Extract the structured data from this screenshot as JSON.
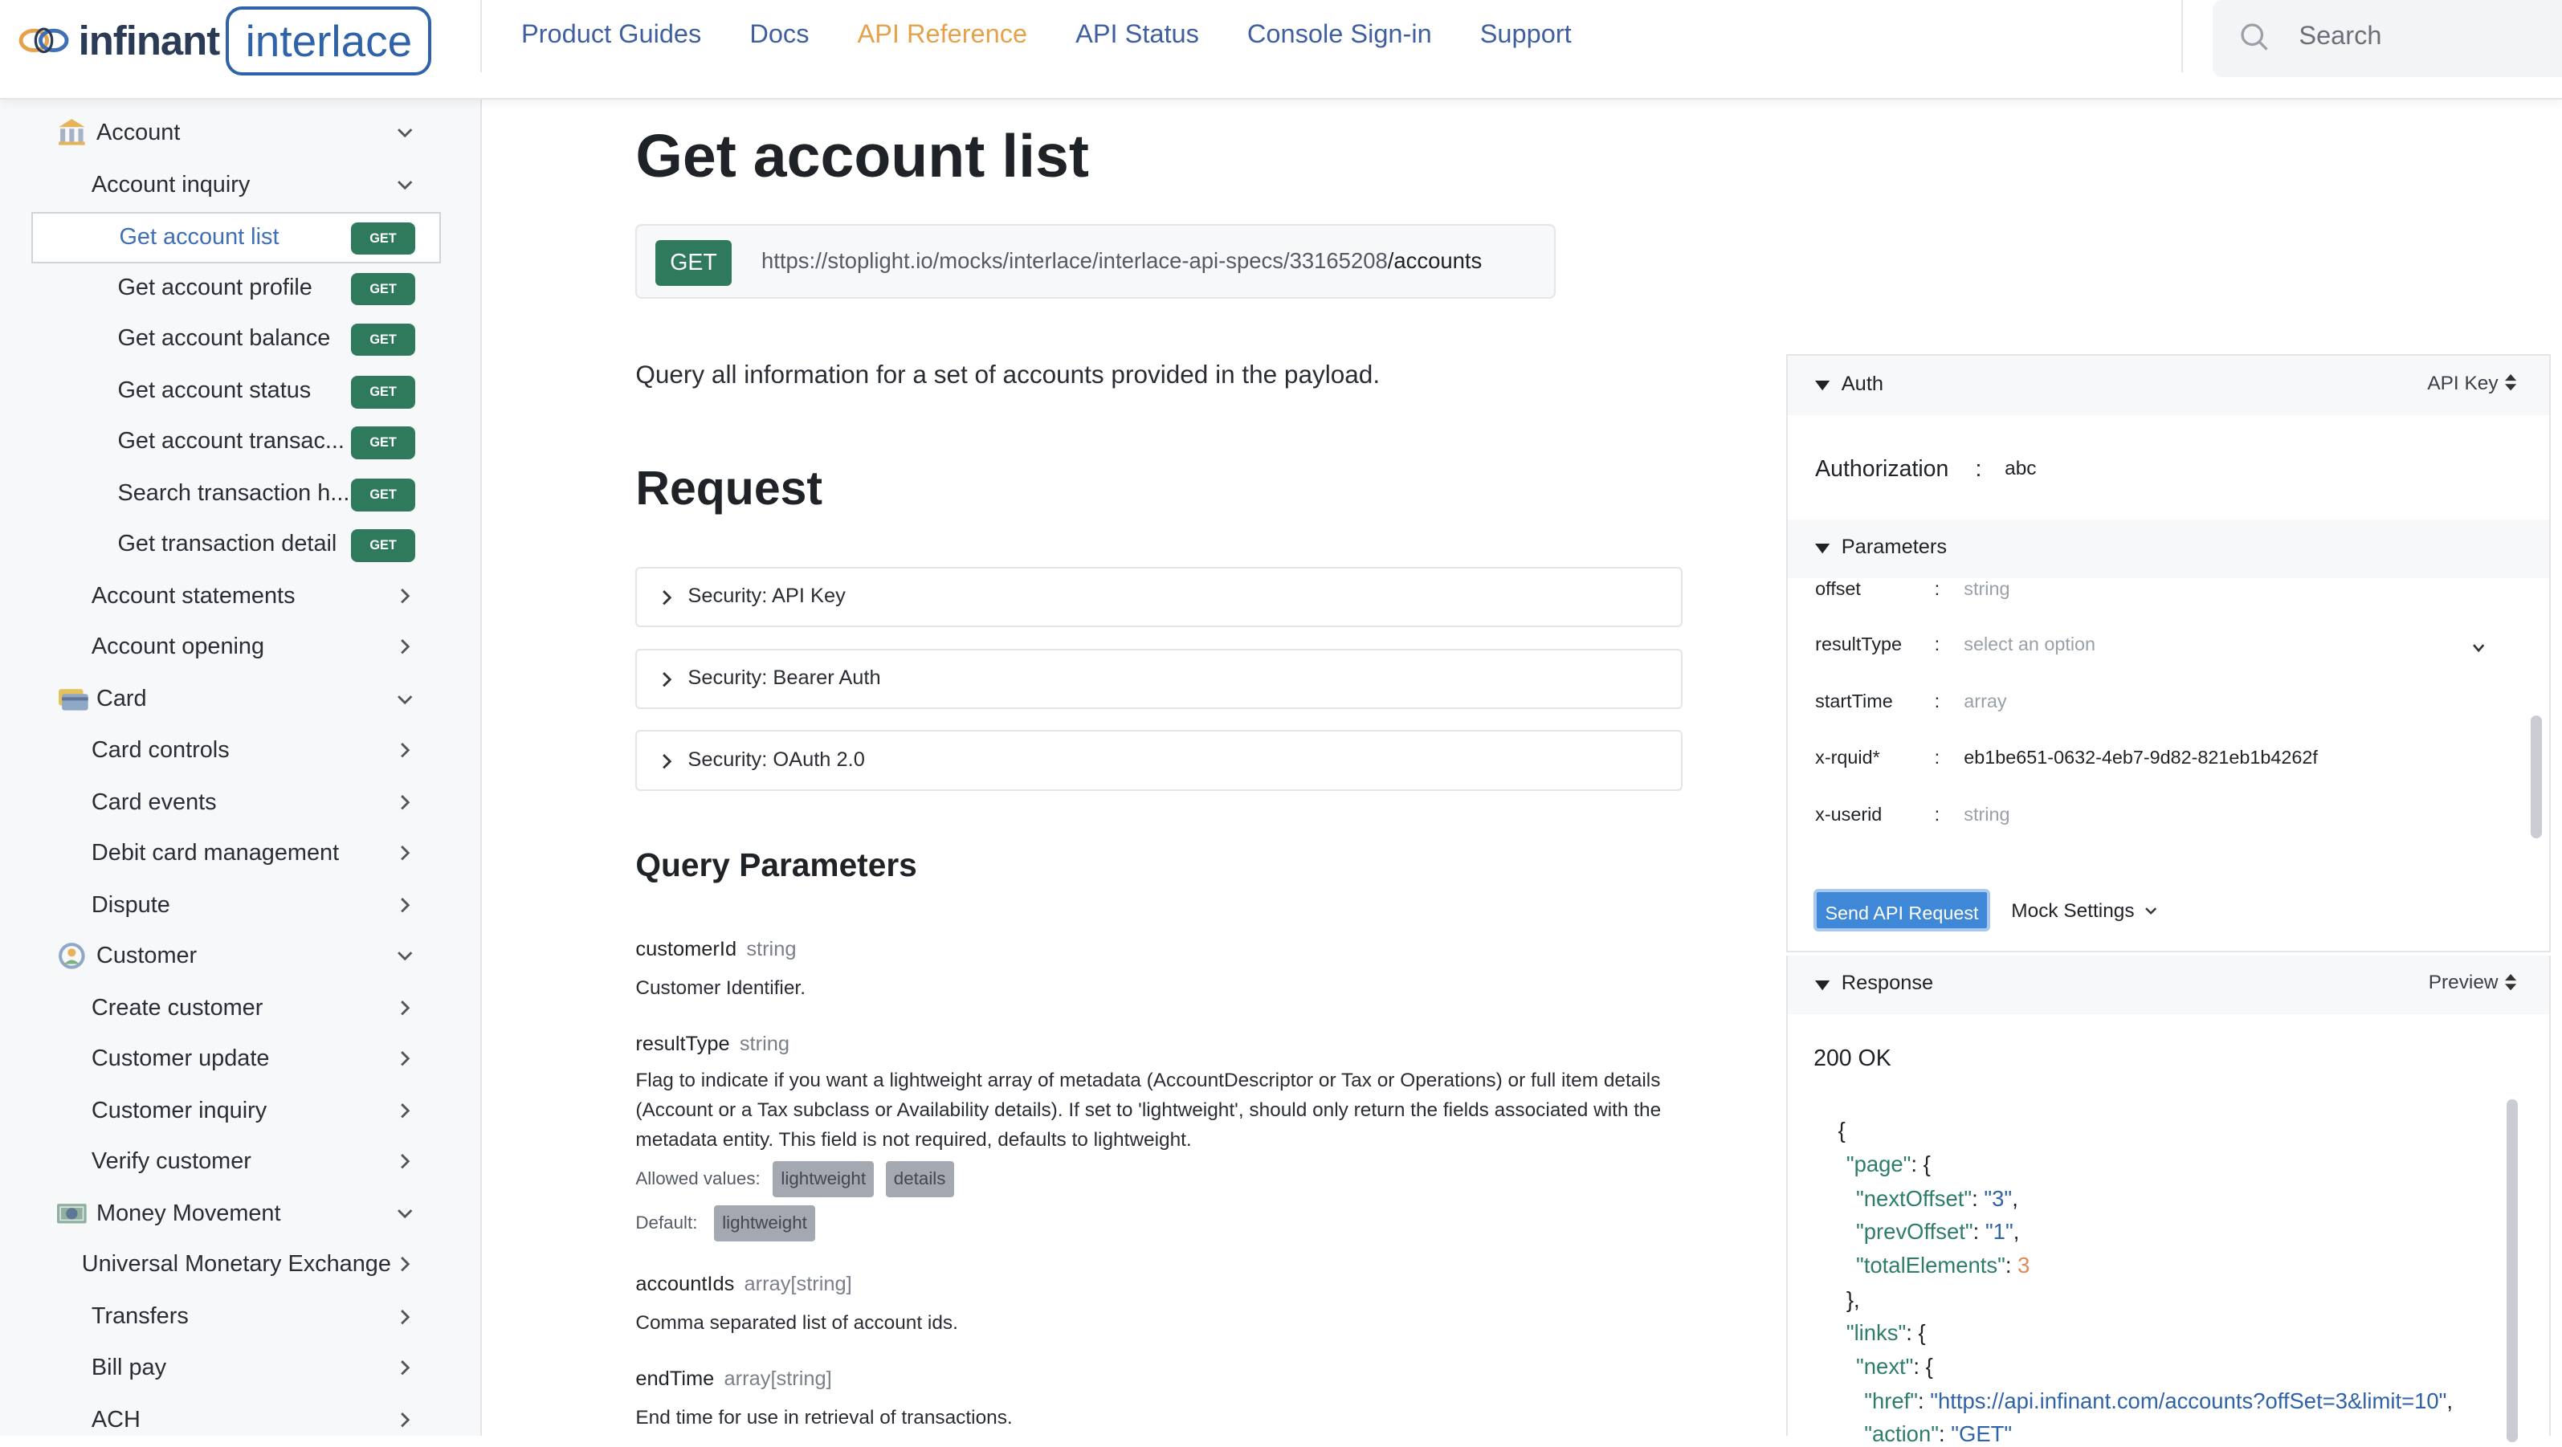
{
  "brand": {
    "logo_text": "infinant",
    "badge_text": "interlace"
  },
  "nav": [
    {
      "label": "Product Guides",
      "active": false
    },
    {
      "label": "Docs",
      "active": false
    },
    {
      "label": "API Reference",
      "active": true
    },
    {
      "label": "API Status",
      "active": false
    },
    {
      "label": "Console Sign-in",
      "active": false
    },
    {
      "label": "Support",
      "active": false
    }
  ],
  "search": {
    "placeholder": "Search"
  },
  "sidebar": {
    "items": [
      {
        "label": "Account",
        "icon": "bank-icon",
        "expanded": true
      },
      {
        "label": "Account inquiry",
        "expanded": true
      },
      {
        "label": "Get account list",
        "badge": "GET",
        "selected": true
      },
      {
        "label": "Get account profile",
        "badge": "GET"
      },
      {
        "label": "Get account balance",
        "badge": "GET"
      },
      {
        "label": "Get account status",
        "badge": "GET"
      },
      {
        "label": "Get account transac...",
        "badge": "GET"
      },
      {
        "label": "Search transaction h...",
        "badge": "GET"
      },
      {
        "label": "Get transaction detail",
        "badge": "GET"
      },
      {
        "label": "Account statements"
      },
      {
        "label": "Account opening"
      },
      {
        "label": "Card",
        "icon": "card-icon",
        "expanded": true
      },
      {
        "label": "Card controls"
      },
      {
        "label": "Card events"
      },
      {
        "label": "Debit card management"
      },
      {
        "label": "Dispute"
      },
      {
        "label": "Customer",
        "icon": "customer-icon",
        "expanded": true
      },
      {
        "label": "Create customer"
      },
      {
        "label": "Customer update"
      },
      {
        "label": "Customer inquiry"
      },
      {
        "label": "Verify customer"
      },
      {
        "label": "Money Movement",
        "icon": "money-icon",
        "expanded": true
      },
      {
        "label": "Universal Monetary Exchange"
      },
      {
        "label": "Transfers"
      },
      {
        "label": "Bill pay"
      },
      {
        "label": "ACH"
      }
    ]
  },
  "main": {
    "title": "Get account list",
    "method": "GET",
    "url_base": "https://stoplight.io/mocks/interlace/interlace-api-specs/33165208",
    "url_path": "/accounts",
    "description": "Query all information for a set of accounts provided in the payload.",
    "request_heading": "Request",
    "security": [
      "Security: API Key",
      "Security: Bearer Auth",
      "Security: OAuth 2.0"
    ],
    "query_heading": "Query Parameters",
    "params": [
      {
        "name": "customerId",
        "type": "string",
        "desc": "Customer Identifier."
      },
      {
        "name": "resultType",
        "type": "string",
        "desc": "Flag to indicate if you want a lightweight array of metadata (AccountDescriptor or Tax or Operations) or full item details (Account or a Tax subclass or Availability details). If set to 'lightweight', should only return the fields associated with the metadata entity. This field is not required, defaults to lightweight."
      },
      {
        "name": "accountIds",
        "type": "array[string]",
        "desc": "Comma separated list of account ids."
      },
      {
        "name": "endTime",
        "type": "array[string]",
        "desc": "End time for use in retrieval of transactions."
      }
    ],
    "allowed_label": "Allowed values:",
    "allowed_values": [
      "lightweight",
      "details"
    ],
    "default_label": "Default:",
    "default_value": "lightweight"
  },
  "panel": {
    "auth_title": "Auth",
    "auth_mode": "API Key",
    "auth_key": "Authorization",
    "auth_value": "abc",
    "params_title": "Parameters",
    "rows": [
      {
        "name": "offset",
        "value": "string",
        "filled": false
      },
      {
        "name": "resultType",
        "value": "select an option",
        "filled": false
      },
      {
        "name": "startTime",
        "value": "array",
        "filled": false
      },
      {
        "name": "x-rquid*",
        "value": "eb1be651-0632-4eb7-9d82-821eb1b4262f",
        "filled": true
      },
      {
        "name": "x-userid",
        "value": "string",
        "filled": false
      }
    ],
    "send_label": "Send API Request",
    "mock_label": "Mock Settings",
    "response_title": "Response",
    "response_mode": "Preview",
    "status": "200 OK",
    "json": {
      "page_key": "\"page\"",
      "next_offset_key": "\"nextOffset\"",
      "next_offset_val": "\"3\"",
      "prev_offset_key": "\"prevOffset\"",
      "prev_offset_val": "\"1\"",
      "total_key": "\"totalElements\"",
      "total_val": "3",
      "links_key": "\"links\"",
      "next_key": "\"next\"",
      "href_key": "\"href\"",
      "href_val": "\"https://api.infinant.com/accounts?offSet=3&limit=10\"",
      "action_key": "\"action\"",
      "action_val": "\"GET\""
    }
  },
  "colors": {
    "accent": "#e6a24a",
    "link": "#3f5fa0",
    "get_badge": "#2f7a5c",
    "send_button": "#3f88d8"
  }
}
